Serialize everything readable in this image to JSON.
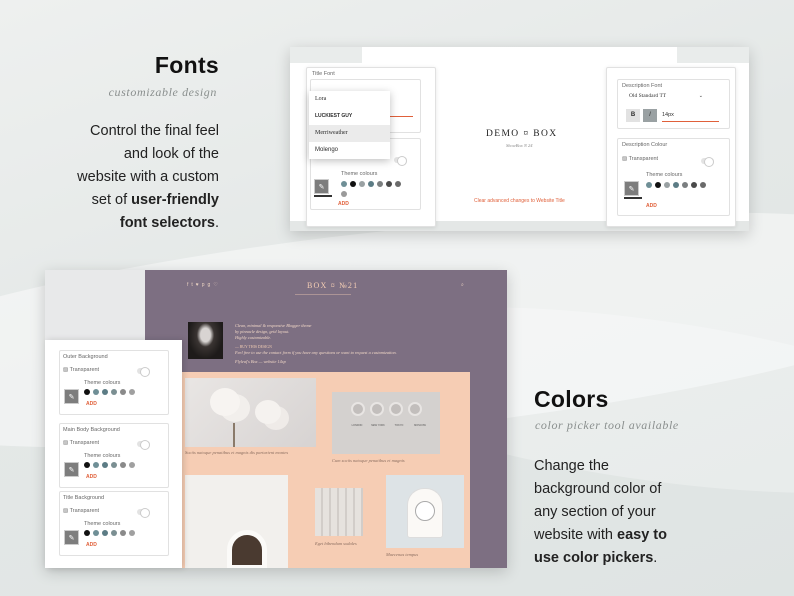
{
  "fonts_section": {
    "title": "Fonts",
    "subtitle": "customizable design",
    "body_lines": [
      "Control the final feel",
      "and look of the",
      "website with a custom"
    ],
    "body_pre": "set of ",
    "body_bold_1": "user-friendly",
    "body_bold_2": "font selectors",
    "body_end": "."
  },
  "colors_section": {
    "title": "Colors",
    "subtitle": "color picker tool available",
    "body_lines": [
      "Change the",
      "background color of",
      "any section of your"
    ],
    "body_pre": "website with ",
    "body_bold_1": "easy to",
    "body_bold_2": "use color pickers",
    "body_end": "."
  },
  "font_screenshot": {
    "left_panel": {
      "title_font_label": "Title Font",
      "dropdown_options": [
        "Lora",
        "LUCKIEST GUY",
        "Merriweather",
        "Molengo"
      ],
      "selected_option": "Merriweather",
      "theme_colours_label": "Theme colours",
      "add_label": "ADD",
      "swatches": [
        "#6f8f96",
        "#111111",
        "#9aa1a3",
        "#5c7c85",
        "#7b7f80",
        "#4a4a4a",
        "#6a6a6a",
        "#9a9a9a"
      ]
    },
    "center": {
      "logo": "DEMO ¤ BOX",
      "tagline": "ShowBox N 24",
      "clear_link": "Clear advanced changes to Website Title"
    },
    "right_panel": {
      "desc_font_label": "Description Font",
      "font_value": "Old Standard TT",
      "bold_btn": "B",
      "italic_btn": "I",
      "size_value": "14px",
      "desc_colour_label": "Description Colour",
      "transparent_label": "Transparent",
      "theme_colours_label": "Theme colours",
      "add_label": "ADD",
      "swatches": [
        "#6f8f96",
        "#111111",
        "#9aa1a3",
        "#5c7c85",
        "#7b7f80",
        "#4a4a4a",
        "#6a6a6a"
      ]
    }
  },
  "color_screenshot": {
    "blog_logo": "BOX ¤ №21",
    "social_icons": [
      "f",
      "t",
      "♥",
      "p",
      "g",
      "♡"
    ],
    "bio_lines": [
      "Clean, minimal & responsive Blogger theme",
      "by pinnacle design, grid layout.",
      "Highly customizable."
    ],
    "bio_link": "— BUY THIS DESIGN",
    "bio_line2": "Feel free to use the contact form if you have any questions or want to request a customization.",
    "bio_footer": "Flyleaf's Box — website 14xp",
    "captions": [
      "Sociis natoque penatibus et magnis dis parturient montes",
      "Cum sociis natoque penatibus et magnis",
      "Eget bibendum sodales",
      "Maecenas tempus"
    ],
    "clock_labels": [
      "LONDON",
      "NEW YORK",
      "TOKYO",
      "MOSCOW"
    ],
    "sidebar_panels": [
      {
        "title": "Outer Background",
        "transparent": "Transparent",
        "theme": "Theme colours",
        "add": "ADD"
      },
      {
        "title": "Main Body Background",
        "transparent": "Transparent",
        "theme": "Theme colours",
        "add": "ADD"
      },
      {
        "title": "Title Background",
        "transparent": "Transparent",
        "theme": "Theme colours",
        "add": "ADD"
      }
    ],
    "swatches": [
      "#111111",
      "#6f8f96",
      "#5c7c85",
      "#7b8f92",
      "#8a8a8a",
      "#a0a0a0"
    ],
    "colors": {
      "outer_bg": "#7d6f82",
      "body_bg": "#f6cdb4",
      "accent": "#e0603a"
    }
  }
}
